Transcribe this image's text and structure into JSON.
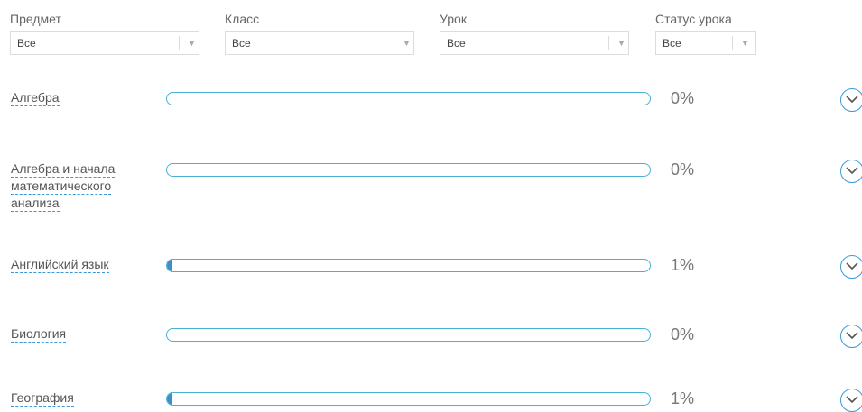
{
  "filters": [
    {
      "label": "Предмет",
      "value": "Все"
    },
    {
      "label": "Класс",
      "value": "Все"
    },
    {
      "label": "Урок",
      "value": "Все"
    },
    {
      "label": "Статус урока",
      "value": "Все"
    }
  ],
  "subjects": [
    {
      "name": "Алгебра",
      "percent": "0%",
      "progress": 0
    },
    {
      "name": "Алгебра и начала математического анализа",
      "percent": "0%",
      "progress": 0
    },
    {
      "name": "Английский язык",
      "percent": "1%",
      "progress": 0.01
    },
    {
      "name": "Биология",
      "percent": "0%",
      "progress": 0
    },
    {
      "name": "География",
      "percent": "1%",
      "progress": 0.01
    }
  ],
  "icons": {
    "expand": "chevron-down-icon",
    "select_caret": "caret-down-icon"
  },
  "colors": {
    "bar_border": "#49b1d4",
    "bar_fill": "#3d8fc6",
    "link_underline": "#3a9ad9"
  }
}
